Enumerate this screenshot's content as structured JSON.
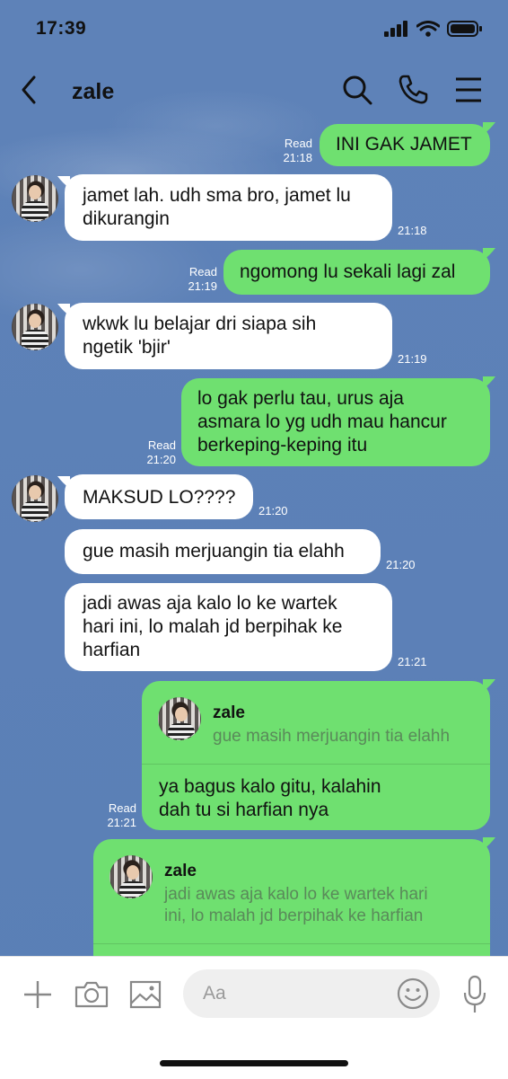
{
  "status": {
    "time": "17:39"
  },
  "header": {
    "title": "zale"
  },
  "messages": {
    "m1": {
      "text": "INI GAK JAMET",
      "status": "Read",
      "time": "21:18"
    },
    "m2": {
      "line1": "jamet lah. udh sma bro, jamet lu",
      "line2": "dikurangin",
      "time": "21:18"
    },
    "m3": {
      "text": "ngomong lu sekali lagi zal",
      "status": "Read",
      "time": "21:19"
    },
    "m4": {
      "line1": "wkwk lu belajar dri siapa sih",
      "line2": "ngetik 'bjir'",
      "time": "21:19"
    },
    "m5": {
      "line1": "lo gak perlu tau, urus aja",
      "line2": "asmara lo yg udh mau hancur",
      "line3": "berkeping-keping itu",
      "status": "Read",
      "time": "21:20"
    },
    "m6": {
      "text": "MAKSUD LO????",
      "time": "21:20"
    },
    "m7": {
      "text": "gue masih merjuangin tia elahh",
      "time": "21:20"
    },
    "m8": {
      "line1": "jadi awas aja kalo lo ke wartek",
      "line2": "hari ini, lo malah jd berpihak ke",
      "line3": "harfian",
      "time": "21:21"
    },
    "m9": {
      "reply_name": "zale",
      "reply_text": "gue masih merjuangin tia elahh",
      "line1": "ya bagus kalo gitu, kalahin",
      "line2": "dah tu si harfian nya",
      "status": "Read",
      "time": "21:21"
    },
    "m10": {
      "reply_name": "zale",
      "reply_line1": "jadi awas aja kalo lo ke wartek hari",
      "reply_line2": "ini, lo malah jd berpihak ke harfian"
    }
  },
  "input": {
    "placeholder": "Aa"
  },
  "colors": {
    "background": "#5b80b7",
    "outgoing": "#6fe070",
    "incoming": "#ffffff"
  },
  "icons": [
    "back-icon",
    "search-icon",
    "phone-icon",
    "menu-icon",
    "plus-icon",
    "camera-icon",
    "image-icon",
    "emoji-icon",
    "mic-icon"
  ]
}
